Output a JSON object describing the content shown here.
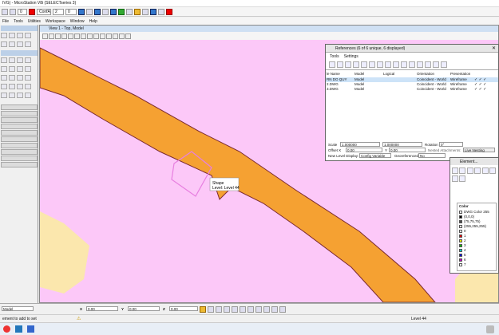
{
  "app": {
    "title": "IVG) - MicroStation V8i (SELECTseries 3)"
  },
  "toolbar": {
    "level_combo": "0",
    "linestyle_combo": "ConfA",
    "weight_combo": "2",
    "color_combo": "0"
  },
  "menubar": {
    "items": [
      "File",
      "Tools",
      "Utilities",
      "Workspace",
      "Window",
      "Help"
    ]
  },
  "view": {
    "title": "View 1 - Top, Model",
    "tooltip_line1": "Shape",
    "tooltip_line2": "Level: Level 44"
  },
  "references": {
    "title": "References (6 of 6 unique, 6 displayed)",
    "menu": [
      "Tools",
      "Settings"
    ],
    "headers": [
      "le Name",
      "Model",
      "Logical",
      "Orientation",
      "Presentation"
    ],
    "rows": [
      {
        "name": "RN DO QUY",
        "model": "Model",
        "logical": "",
        "orientation": "Coincident - World",
        "presentation": "Wireframe"
      },
      {
        "name": "2.DWG",
        "model": "Model",
        "logical": "",
        "orientation": "Coincident - World",
        "presentation": "Wireframe"
      },
      {
        "name": "3.DWG",
        "model": "Model",
        "logical": "",
        "orientation": "Coincident - World",
        "presentation": "Wireframe"
      }
    ],
    "scale_label": "Scale",
    "scale_a": "1.000000",
    "scale_b": "1.000000",
    "rotation_label": "Rotation",
    "rotation_value": "0°",
    "offset_label": "Offset X",
    "offset_x": "0.00",
    "offset_y_label": "Y",
    "offset_y": "0.00",
    "nested_label": "Nested Attachments:",
    "nested_value": "Live Nesting",
    "newlevel_label": "New Level Display:",
    "newlevel_value": "Config Variable",
    "georef_label": "Georeferenced:",
    "georef_value": "No"
  },
  "element": {
    "title": "Element...",
    "color_header": "Color",
    "colors": [
      {
        "name": "DWG Color 255",
        "hex": "#ffffff"
      },
      {
        "name": "(0,0,0)",
        "hex": "#000000"
      },
      {
        "name": "(75,75,75)",
        "hex": "#4b4b4b"
      },
      {
        "name": "(255,255,255)",
        "hex": "#ffffff"
      },
      {
        "name": "0",
        "hex": "#ffffff"
      },
      {
        "name": "1",
        "hex": "#e00000"
      },
      {
        "name": "2",
        "hex": "#e8e800"
      },
      {
        "name": "3",
        "hex": "#00b000"
      },
      {
        "name": "4",
        "hex": "#00c8c8"
      },
      {
        "name": "5",
        "hex": "#0000d0"
      },
      {
        "name": "6",
        "hex": "#c000c0"
      },
      {
        "name": "7",
        "hex": "#ffffff"
      }
    ]
  },
  "bottombar": {
    "model_label": "Model",
    "x_label": "X",
    "x_value": "0.00",
    "y_label": "Y",
    "y_value": "0.00",
    "z_label": "Z",
    "z_value": "0.00"
  },
  "status": {
    "prompt": "ement to add to set",
    "level": "Level 44"
  },
  "colors": {
    "bg_pink": "#fcc8f8",
    "road_orange": "#f5a132",
    "edge_dark": "#7a2a30",
    "yellow": "#fbe7ad",
    "shape_stroke": "#e77fe0"
  }
}
